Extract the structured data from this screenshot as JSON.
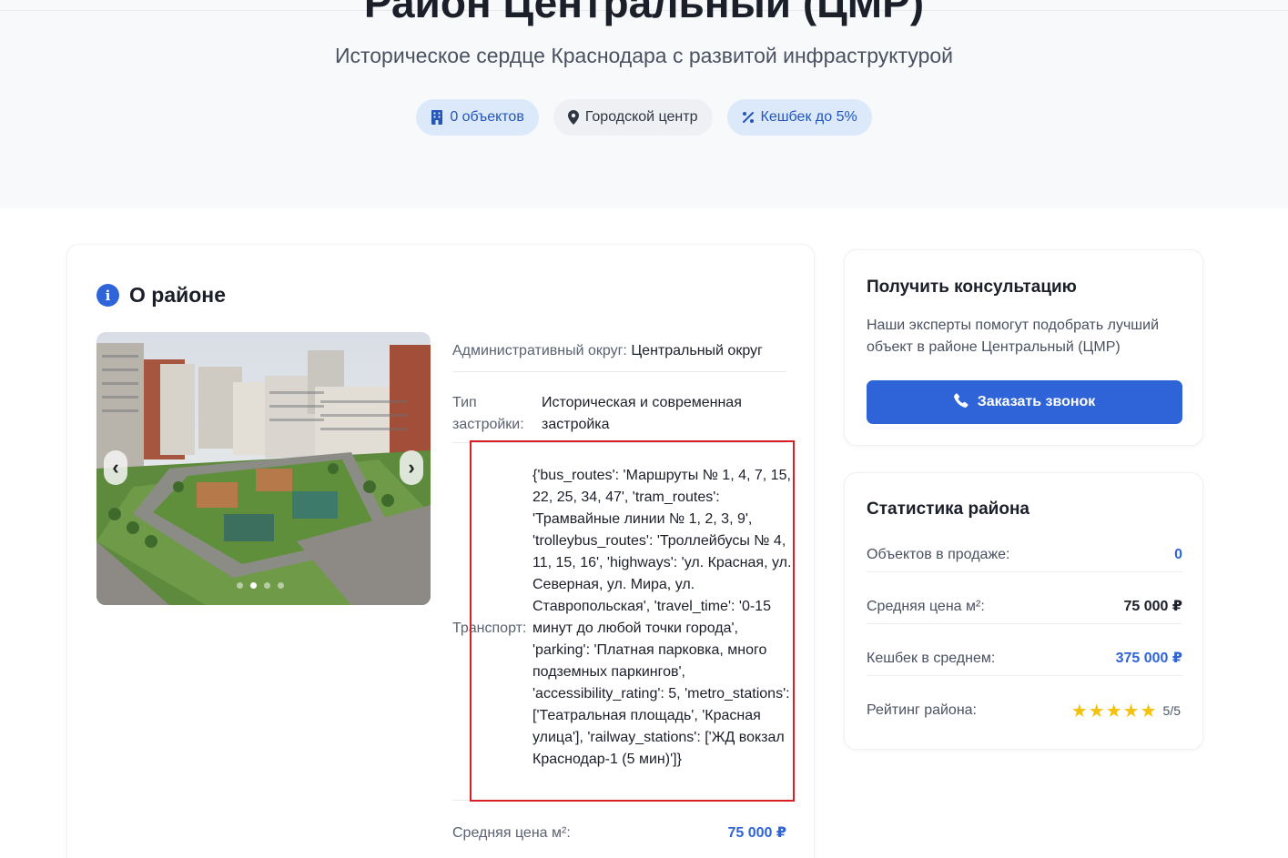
{
  "hero": {
    "title": "Район Центральный (ЦМР)",
    "subtitle": "Историческое сердце Краснодара с развитой инфраструктурой",
    "chips": [
      {
        "label": "0 объектов",
        "icon": "building-icon",
        "color": "#2456b8"
      },
      {
        "label": "Городской центр",
        "icon": "map-pin-icon",
        "color": "#2f3542"
      },
      {
        "label": "Кешбек до 5%",
        "icon": "percent-icon",
        "color": "#2456b8"
      }
    ]
  },
  "about": {
    "heading": "О районе",
    "gallery": {
      "slides": 4,
      "active": 2
    },
    "admin_label": "Административный округ:",
    "admin_value": "Центральный округ",
    "type_label": "Тип застройки:",
    "type_value": "Историческая и современная застройка",
    "transport_label": "Транспорт:",
    "transport_value": "{'bus_routes': 'Маршруты № 1, 4, 7, 15, 22, 25, 34, 47', 'tram_routes': 'Трамвайные линии № 1, 2, 3, 9', 'trolleybus_routes': 'Троллейбусы № 4, 11, 15, 16', 'highways': 'ул. Красная, ул. Северная, ул. Мира, ул. Ставропольская', 'travel_time': '0-15 минут до любой точки города', 'parking': 'Платная парковка, много подземных паркингов', 'accessibility_rating': 5, 'metro_stations': ['Театральная площадь', 'Красная улица'], 'railway_stations': ['ЖД вокзал Краснодар-1 (5 мин)']}",
    "price_label": "Средняя цена м²:",
    "price_value": "75 000 ₽"
  },
  "consult": {
    "title": "Получить консультацию",
    "text": "Наши эксперты помогут подобрать лучший объект в районе Центральный (ЦМР)",
    "button": "Заказать звонок"
  },
  "stats": {
    "title": "Статистика района",
    "rows": [
      {
        "label": "Объектов в продаже:",
        "value": "0"
      },
      {
        "label": "Средняя цена м²:",
        "value": "75 000 ₽"
      },
      {
        "label": "Кешбек в среднем:",
        "value": "375 000 ₽"
      }
    ],
    "rating_label": "Рейтинг района:",
    "rating_value": 5,
    "rating_text": "5/5"
  },
  "colors": {
    "accent": "#2f64d8",
    "star": "#f4c20d",
    "highlight": "#d81f26"
  }
}
